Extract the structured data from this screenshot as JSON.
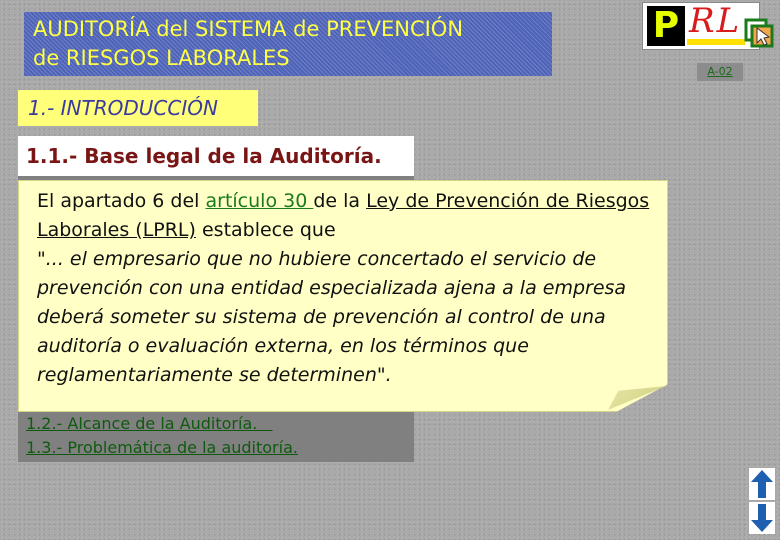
{
  "header": {
    "title_line1": "AUDITORÍA del SISTEMA de PREVENCIÓN",
    "title_line2": "de RIESGOS LABORALES"
  },
  "logo": {
    "p": "P",
    "rl": "RL"
  },
  "page_code": "A-02",
  "section": {
    "title": "1.- INTRODUCCIÓN"
  },
  "subsection": {
    "title": "1.1.- Base legal de la Auditoría."
  },
  "callout": {
    "prefix": "El apartado 6 del ",
    "article_link": "artículo 30 ",
    "middle": "de la ",
    "law_name": "Ley de Prevención de Riesgos Laborales (LPRL)",
    "suffix": " establece que",
    "quote": "\"... el empresario que no hubiere concertado el servicio de prevención con una entidad especializada ajena a la empresa deberá someter su sistema de prevención al control de una auditoría o evaluación externa, en los términos que reglamentariamente se determinen\"."
  },
  "links": [
    {
      "label": "1.2.- Alcance de la Auditoría.   "
    },
    {
      "label": "1.3.- Problemática de la auditoría."
    }
  ],
  "colors": {
    "title_bg": "#4e63b8",
    "title_text": "#ffff44",
    "section_bg": "#ffff7a",
    "callout_bg": "#ffffc6",
    "link": "#0f5a0f",
    "subsection_text": "#7a1515"
  },
  "icons": {
    "exit": "exit-icon",
    "up": "arrow-up-icon",
    "down": "arrow-down-icon"
  }
}
